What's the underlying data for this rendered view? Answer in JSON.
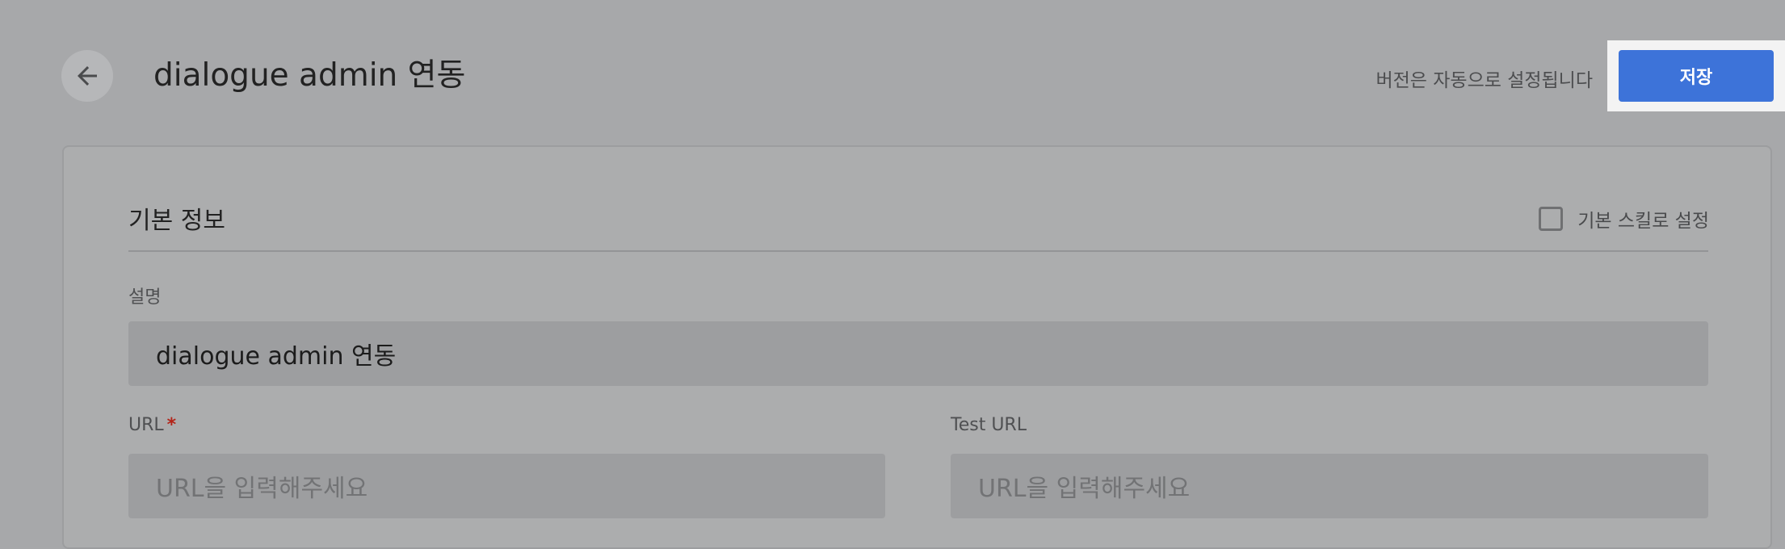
{
  "header": {
    "back_icon": "arrow-left-icon",
    "title": "dialogue admin 연동",
    "version_note": "버전은 자동으로 설정됩니다",
    "save_label": "저장"
  },
  "colors": {
    "accent": "#3d73d9",
    "required": "#b42318",
    "background": "#a7a8aa"
  },
  "basic_info": {
    "section_title": "기본 정보",
    "default_skill_label": "기본 스킬로 설정",
    "default_skill_checked": false,
    "description": {
      "label": "설명",
      "value": "dialogue admin 연동"
    },
    "url": {
      "label": "URL",
      "required_mark": "*",
      "placeholder": "URL을 입력해주세요"
    },
    "test_url": {
      "label": "Test URL",
      "placeholder": "URL을 입력해주세요"
    }
  }
}
